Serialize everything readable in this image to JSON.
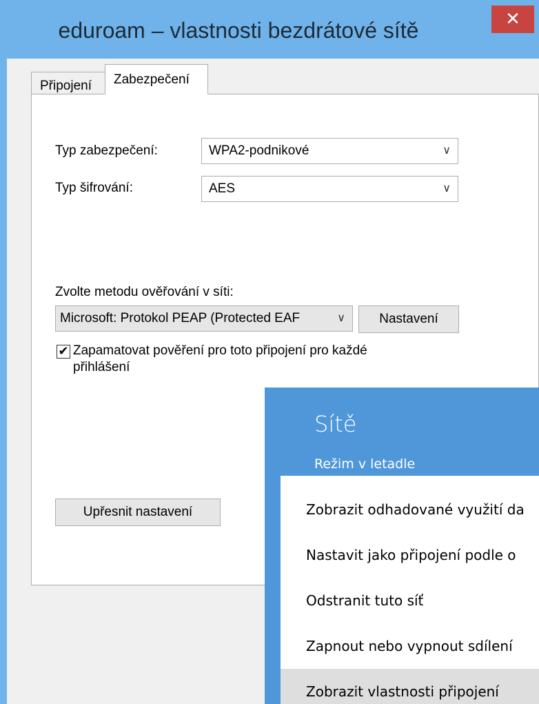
{
  "window": {
    "title": "eduroam – vlastnosti bezdrátové sítě",
    "close_glyph": "✕"
  },
  "tabs": [
    {
      "label": "Připojení",
      "active": false
    },
    {
      "label": "Zabezpečení",
      "active": true
    }
  ],
  "security": {
    "type_label": "Typ zabezpečení:",
    "type_value": "WPA2-podnikové",
    "encryption_label": "Typ šifrování:",
    "encryption_value": "AES",
    "method_label": "Zvolte metodu ověřování v síti:",
    "method_value": "Microsoft: Protokol PEAP (Protected EAF",
    "settings_button": "Nastavení",
    "remember_label_1": "Zapamatovat pověření pro toto připojení pro každé",
    "remember_label_2": "přihlášení",
    "remember_checked": true,
    "advanced_button": "Upřesnit nastavení"
  },
  "icons": {
    "chevron": "chevron-down-icon",
    "check": "✔"
  },
  "flyout": {
    "title": "Sítě",
    "airplane_mode": "Režim v letadle",
    "menu": [
      "Zobrazit odhadované využití da",
      "Nastavit jako připojení podle o",
      "Odstranit tuto síť",
      "Zapnout nebo vypnout sdílení",
      "Zobrazit vlastnosti připojení"
    ]
  },
  "colors": {
    "title_bar": "#6fb3ea",
    "close": "#c74440",
    "flyout": "#4f97d8"
  }
}
